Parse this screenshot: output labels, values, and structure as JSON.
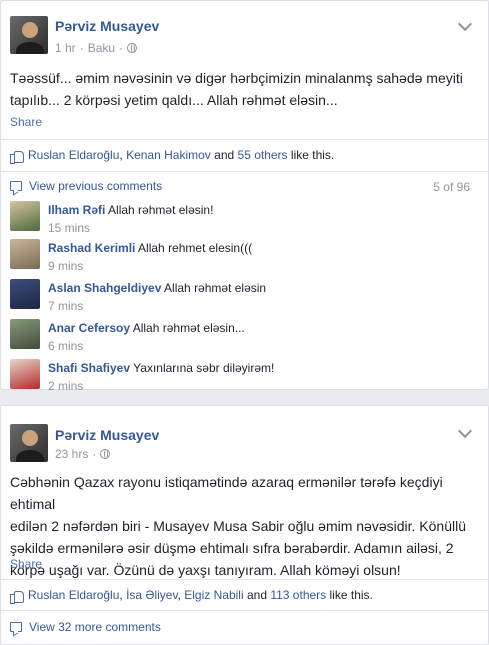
{
  "post1": {
    "author": "Pərviz Musayev",
    "time": "1 hr",
    "location": "Baku",
    "text_line1": "Təəssüf... əmim nəvəsinin və digər hərbçimizin minalanmş sahədə meyiti",
    "text_line2": "tapılıb... 2 körpəsi yetim qaldı... Allah rəhmət eləsin...",
    "share_label": "Share",
    "likes": {
      "name1": "Ruslan Eldaroğlu",
      "comma": ",",
      "name2": "Kenan Hakimov",
      "and": "and",
      "others": "55 others",
      "suffix": "like this."
    },
    "view_previous": "View previous comments",
    "comment_count": "5 of 96",
    "comments": [
      {
        "name": "Ilham Rəfi",
        "text": "Allah rəhmət eləsin!",
        "time": "15 mins"
      },
      {
        "name": "Rashad Kerimli",
        "text": "Allah rehmet elesin(((",
        "time": "9 mins"
      },
      {
        "name": "Aslan Shahgeldiyev",
        "text": "Allah rəhmət eləsin",
        "time": "7 mins"
      },
      {
        "name": "Anar Cefersoy",
        "text": "Allah rəhmət eləsin...",
        "time": "6 mins"
      },
      {
        "name": "Shafi Shafiyev",
        "text": "Yaxınlarına səbr diləyirəm!",
        "time": "2 mins"
      }
    ]
  },
  "post2": {
    "author": "Pərviz Musayev",
    "time": "23 hrs",
    "text_line1": "Cəbhənin Qazax rayonu istiqamətində azaraq ermənilər tərəfə keçdiyi ehtimal",
    "text_line2": "edilən 2 nəfərdən biri - Musayev Musa Sabir oğlu əmim nəvəsidir. Könüllü",
    "text_line3": "şəkildə ermənilərə əsir düşmə ehtimalı sıfra bərabərdir. Adamın ailəsi, 2",
    "text_line4": "körpə uşağı var. Özünü də yaxşı tanıyıram. Allah köməyi olsun!",
    "share_label": "Share",
    "likes": {
      "name1": "Ruslan Eldaroğlu",
      "comma1": ",",
      "name2": "İsa Əliyev",
      "comma2": ",",
      "name3": "Elgiz Nabili",
      "and": "and",
      "others": "113 others",
      "suffix": "like this."
    },
    "view_more": "View 32 more comments"
  },
  "colors": {
    "link": "#365899",
    "meta": "#90949c",
    "background": "#e9ebee"
  }
}
